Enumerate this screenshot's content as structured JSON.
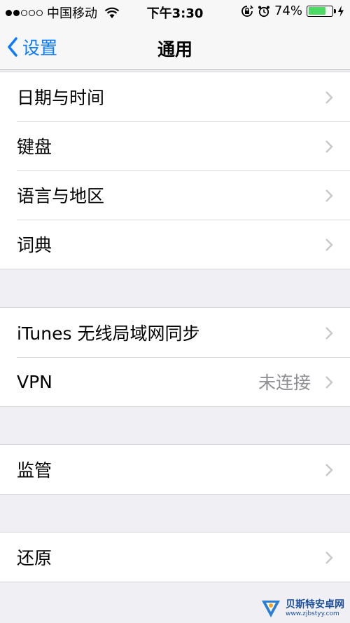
{
  "status_bar": {
    "carrier": "中国移动",
    "time": "下午3:30",
    "battery_percent": "74%",
    "battery_level": 0.74,
    "signal_bars_filled": 2,
    "signal_bars_total": 5,
    "icons": [
      "wifi-icon",
      "rotation-lock-icon",
      "alarm-icon",
      "battery-icon",
      "charging-bolt-icon"
    ]
  },
  "nav": {
    "back_label": "设置",
    "title": "通用"
  },
  "groups": [
    {
      "rows": [
        {
          "label": "日期与时间"
        },
        {
          "label": "键盘"
        },
        {
          "label": "语言与地区"
        },
        {
          "label": "词典"
        }
      ]
    },
    {
      "rows": [
        {
          "label": "iTunes 无线局域网同步"
        },
        {
          "label": "VPN",
          "detail": "未连接"
        }
      ]
    },
    {
      "rows": [
        {
          "label": "监管"
        }
      ]
    },
    {
      "rows": [
        {
          "label": "还原"
        }
      ]
    }
  ],
  "watermark": {
    "title": "贝斯特安卓网",
    "url": "www.zjbstyy.com"
  },
  "colors": {
    "accent": "#0a7aff",
    "background": "#efeff4",
    "battery": "#4cd964",
    "secondary_text": "#8e8e93"
  }
}
